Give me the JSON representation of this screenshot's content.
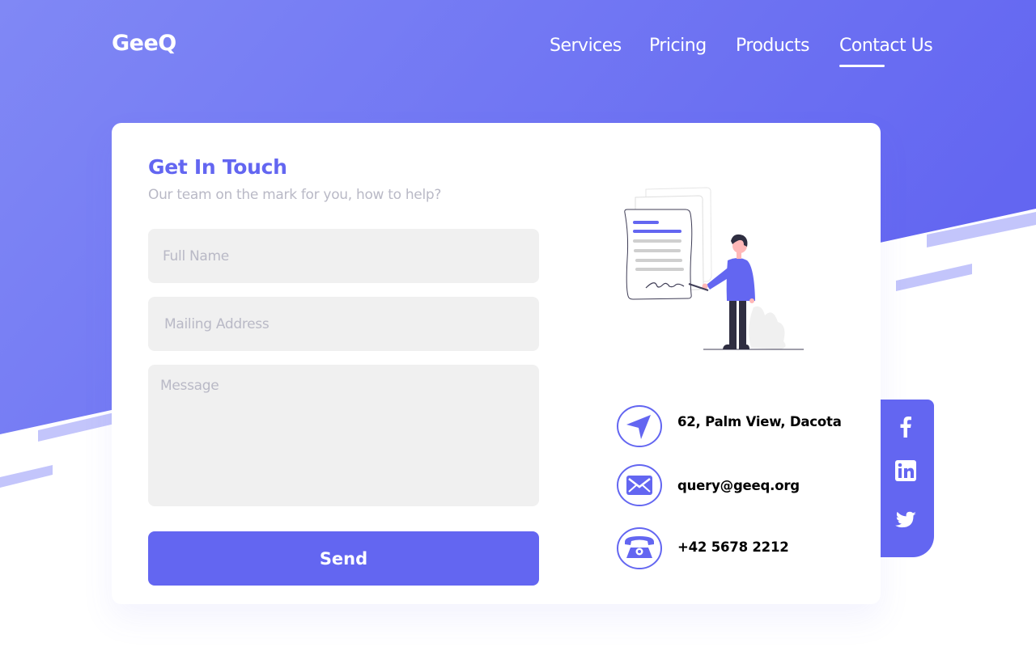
{
  "brand": {
    "name": "GeeQ"
  },
  "nav": {
    "items": [
      {
        "label": "Services"
      },
      {
        "label": "Pricing"
      },
      {
        "label": "Products"
      },
      {
        "label": "Contact Us",
        "active": true
      }
    ]
  },
  "contact_form": {
    "title": "Get In Touch",
    "subtitle": "Our team on the mark for you, how to help?",
    "full_name": {
      "placeholder": "Full Name",
      "value": ""
    },
    "mailing_address": {
      "placeholder": "Mailing Address",
      "value": ""
    },
    "message": {
      "placeholder": "Message",
      "value": ""
    },
    "send_label": "Send"
  },
  "contact_info": {
    "address": {
      "icon": "location-arrow-icon",
      "text": "62, Palm View, Dacota"
    },
    "email": {
      "icon": "envelope-icon",
      "text": "query@geeq.org"
    },
    "phone": {
      "icon": "telephone-icon",
      "text": "+42 5678 2212"
    }
  },
  "social": [
    "facebook-icon",
    "linkedin-icon",
    "twitter-icon"
  ],
  "colors": {
    "accent": "#6366f1",
    "gradient_start": "#8088f5",
    "gradient_end": "#6366f1",
    "stripe": "#c3c5fb",
    "input_bg": "#f0f0f0",
    "placeholder": "#b9b9c6"
  }
}
